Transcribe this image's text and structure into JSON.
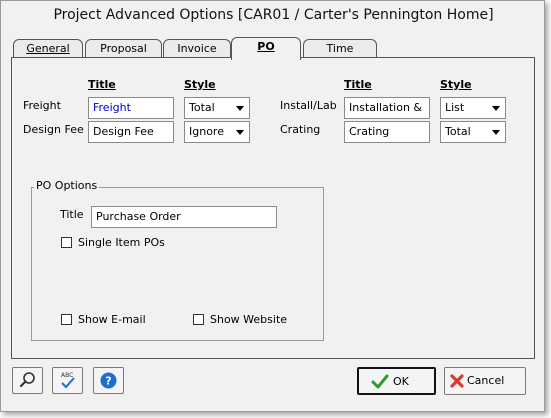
{
  "window": {
    "title": "Project Advanced Options [CAR01 / Carter's Pennington Home]"
  },
  "tabs": [
    {
      "label": "General"
    },
    {
      "label": "Proposal"
    },
    {
      "label": "Invoice"
    },
    {
      "label": "PO",
      "active": true
    },
    {
      "label": "Time"
    }
  ],
  "charges": {
    "left_headers": {
      "title": "Title",
      "style": "Style"
    },
    "right_headers": {
      "title": "Title",
      "style": "Style"
    },
    "freight": {
      "label": "Freight",
      "title": "Freight",
      "style": "Total"
    },
    "design_fee": {
      "label": "Design Fee",
      "title": "Design Fee",
      "style": "Ignore"
    },
    "install_lab": {
      "label": "Install/Lab",
      "title": "Installation &",
      "style": "List"
    },
    "crating": {
      "label": "Crating",
      "title": "Crating",
      "style": "Total"
    }
  },
  "po_options": {
    "group_label": "PO Options",
    "title_label": "Title",
    "title_value": "Purchase Order",
    "single_item_pos": {
      "label": "Single Item POs",
      "checked": false
    },
    "show_email": {
      "label": "Show E-mail",
      "checked": false
    },
    "show_website": {
      "label": "Show Website",
      "checked": false
    }
  },
  "footer": {
    "ok_label": "OK",
    "cancel_label": "Cancel",
    "icons": [
      "magnifier-icon",
      "spellcheck-icon",
      "help-icon"
    ]
  },
  "colors": {
    "freight_text": "#0000cc",
    "ok_check": "#2e9a2e",
    "cancel_x": "#d93a2b",
    "help_blue": "#1f6fd1"
  }
}
